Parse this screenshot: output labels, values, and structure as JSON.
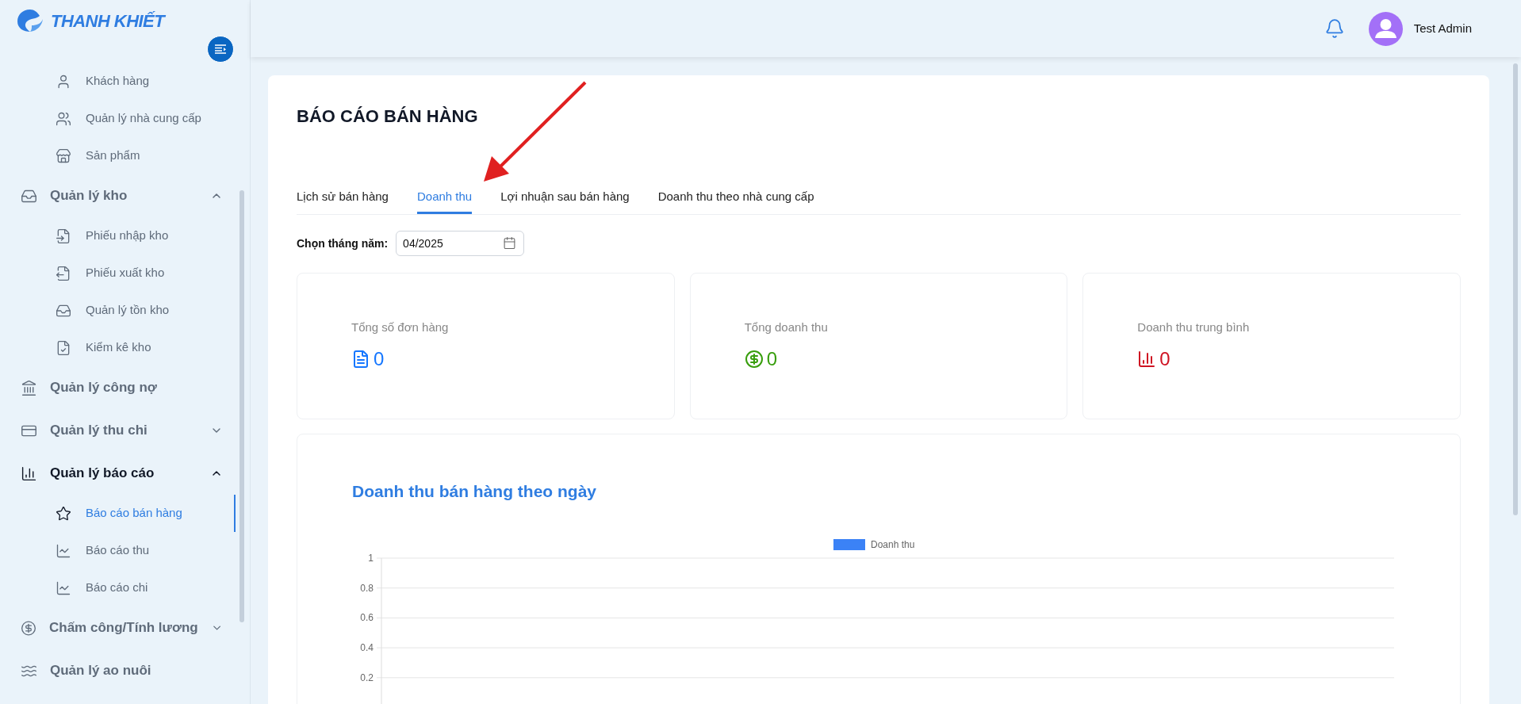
{
  "brand": {
    "name": "THANH KHIẾT"
  },
  "sidebar": {
    "leading_items": [
      {
        "label": "Khách hàng",
        "selected": false
      },
      {
        "label": "Quản lý nhà cung cấp",
        "selected": false
      },
      {
        "label": "Sản phẩm",
        "selected": false
      }
    ],
    "items": [
      {
        "label": "Quản lý kho",
        "kind": "group",
        "expanded": true,
        "selected": false,
        "children": [
          {
            "label": "Phiếu nhập kho",
            "selected": false
          },
          {
            "label": "Phiếu xuất kho",
            "selected": false
          },
          {
            "label": "Quản lý tồn kho",
            "selected": false
          },
          {
            "label": "Kiểm kê kho",
            "selected": false
          }
        ]
      },
      {
        "label": "Quản lý công nợ",
        "kind": "link",
        "selected": false
      },
      {
        "label": "Quản lý thu chi",
        "kind": "group",
        "expanded": false,
        "selected": false
      },
      {
        "label": "Quản lý báo cáo",
        "kind": "group",
        "expanded": true,
        "selected": true,
        "children": [
          {
            "label": "Báo cáo bán hàng",
            "selected": true
          },
          {
            "label": "Báo cáo thu",
            "selected": false
          },
          {
            "label": "Báo cáo chi",
            "selected": false
          }
        ]
      },
      {
        "label": "Chấm công/Tính lương",
        "kind": "group",
        "expanded": false,
        "selected": false
      },
      {
        "label": "Quản lý ao nuôi",
        "kind": "link",
        "selected": false
      }
    ]
  },
  "header": {
    "user_name": "Test Admin"
  },
  "page": {
    "title": "BÁO CÁO BÁN HÀNG",
    "tabs": [
      {
        "label": "Lịch sử bán hàng",
        "selected": false
      },
      {
        "label": "Doanh thu",
        "selected": true
      },
      {
        "label": "Lợi nhuận sau bán hàng",
        "selected": false
      },
      {
        "label": "Doanh thu theo nhà cung cấp",
        "selected": false
      }
    ],
    "month_picker": {
      "label": "Chọn tháng năm:",
      "value": "04/2025"
    },
    "stats": [
      {
        "label": "Tổng số đơn hàng",
        "value": "0",
        "color": "#1677ff"
      },
      {
        "label": "Tổng doanh thu",
        "value": "0",
        "color": "#389e0d"
      },
      {
        "label": "Doanh thu trung bình",
        "value": "0",
        "color": "#cf1322"
      }
    ],
    "chart": {
      "chart_data": {
        "type": "bar",
        "title": "Doanh thu bán hàng theo ngày",
        "grid": true,
        "ylim": [
          0,
          1
        ],
        "yticks": [
          0.2,
          0.4,
          0.6,
          0.8,
          1
        ],
        "series": [
          {
            "name": "Doanh thu",
            "color": "#3b82f6"
          }
        ]
      }
    }
  }
}
